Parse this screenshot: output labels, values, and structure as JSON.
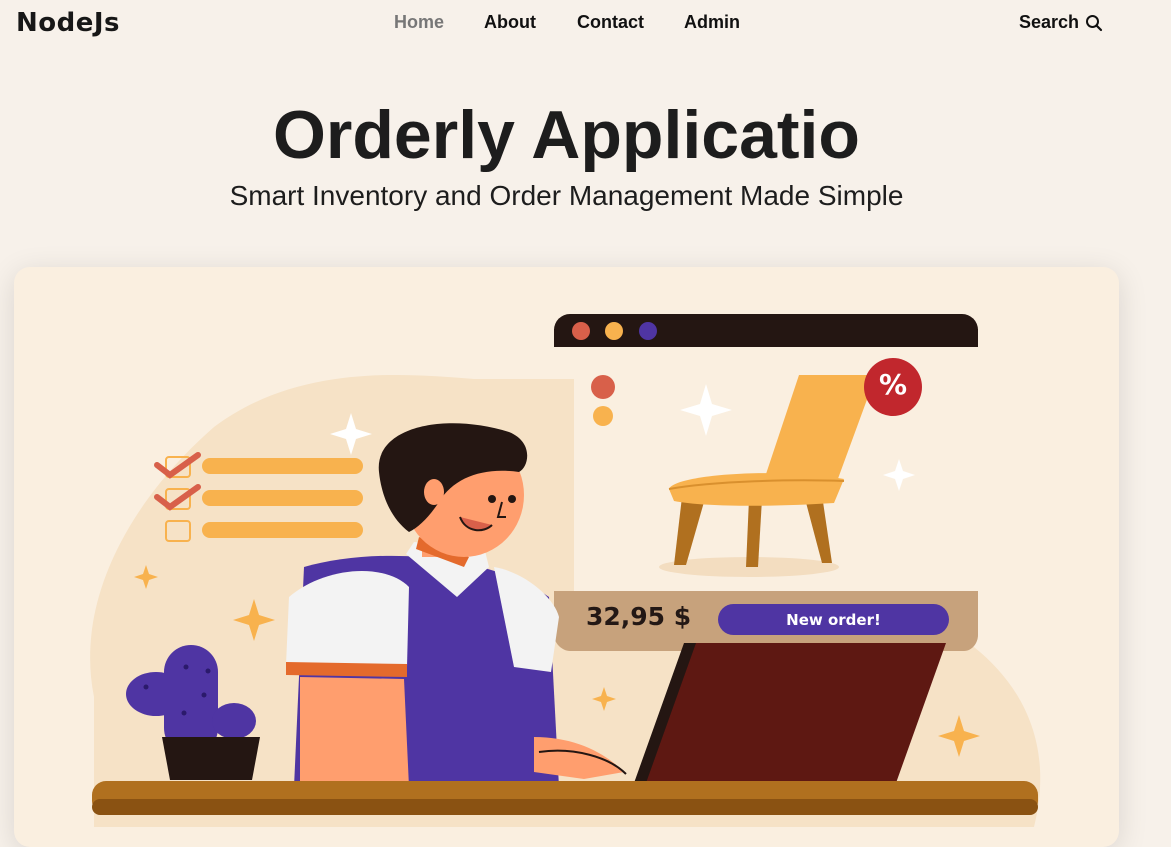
{
  "brand": "NodeJs",
  "nav": {
    "items": [
      {
        "label": "Home",
        "active": true
      },
      {
        "label": "About",
        "active": false
      },
      {
        "label": "Contact",
        "active": false
      },
      {
        "label": "Admin",
        "active": false
      }
    ],
    "search_label": "Search"
  },
  "hero": {
    "title": "Orderly Applicatio",
    "subtitle": "Smart Inventory and Order Management Made Simple"
  },
  "illustration": {
    "price": "32,95 $",
    "order_button": "New order!",
    "discount_badge": "%"
  },
  "colors": {
    "page_background": "#f7f1ea",
    "card_background": "#faefe0",
    "accent_purple": "#4f35a3",
    "accent_orange": "#f8b24e",
    "dark_brown": "#241612"
  }
}
